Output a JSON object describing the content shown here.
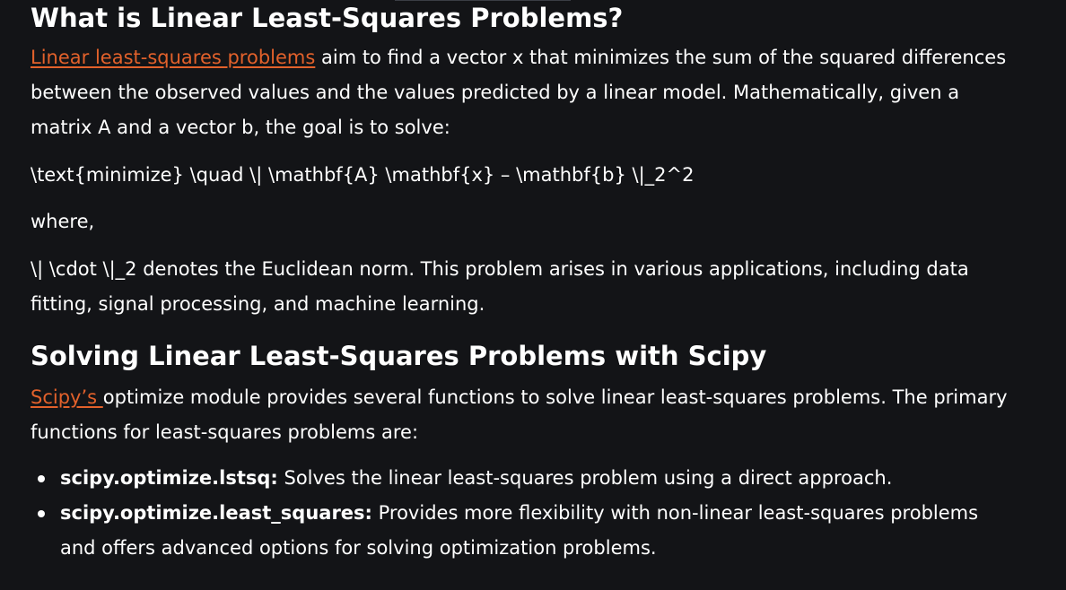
{
  "section1": {
    "title": "What is Linear Least-Squares Problems?",
    "intro_link": "Linear least-squares problems",
    "intro_text": " aim to find a vector x that minimizes the sum of the squared differences between the observed values and the values predicted by a linear model. Mathematically, given a matrix A and a vector b, the goal is to solve:",
    "formula": "\\text{minimize} \\quad \\| \\mathbf{A} \\mathbf{x} – \\mathbf{b} \\|_2^2",
    "where": "where,",
    "norm_text": "\\| \\cdot \\|_2 denotes the Euclidean norm. This problem arises in various applications, including data fitting, signal processing, and machine learning."
  },
  "section2": {
    "title": "Solving Linear Least-Squares Problems with Scipy",
    "intro_link": "Scipy’s ",
    "intro_text": "optimize module provides several functions to solve linear least-squares problems. The primary functions for least-squares problems are:",
    "bullets": [
      {
        "term": "scipy.optimize.lstsq:",
        "text": " Solves the linear least-squares problem using a direct approach."
      },
      {
        "term": "scipy.optimize.least_squares:",
        "text": " Provides more flexibility with non-linear least-squares problems and offers advanced options for solving optimization problems."
      }
    ]
  },
  "colors": {
    "background": "#131417",
    "text": "#ffffff",
    "link": "#e2612b"
  }
}
